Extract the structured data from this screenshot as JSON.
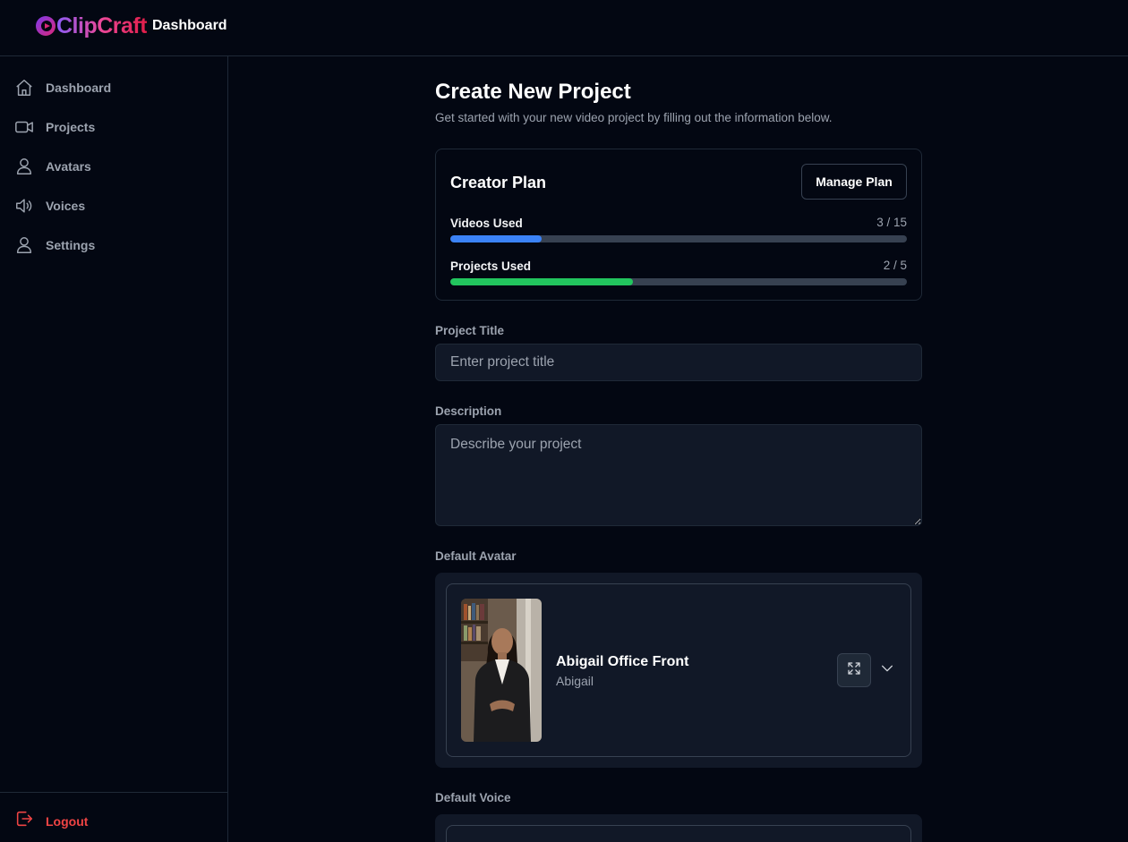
{
  "app": {
    "logo_text": "ClipCraft",
    "header_title": "Dashboard"
  },
  "sidebar": {
    "items": [
      {
        "label": "Dashboard",
        "icon": "home-icon"
      },
      {
        "label": "Projects",
        "icon": "video-camera-icon"
      },
      {
        "label": "Avatars",
        "icon": "user-icon"
      },
      {
        "label": "Voices",
        "icon": "speaker-icon"
      },
      {
        "label": "Settings",
        "icon": "user-icon"
      }
    ],
    "logout_label": "Logout"
  },
  "page": {
    "title": "Create New Project",
    "subtitle": "Get started with your new video project by filling out the information below."
  },
  "plan": {
    "name": "Creator Plan",
    "manage_label": "Manage Plan",
    "videos": {
      "label": "Videos Used",
      "count_text": "3 / 15",
      "used": 3,
      "total": 15,
      "color": "#3b82f6"
    },
    "projects": {
      "label": "Projects Used",
      "count_text": "2 / 5",
      "used": 2,
      "total": 5,
      "color": "#22c55e"
    }
  },
  "form": {
    "title_label": "Project Title",
    "title_placeholder": "Enter project title",
    "title_value": "",
    "description_label": "Description",
    "description_placeholder": "Describe your project",
    "description_value": "",
    "avatar_label": "Default Avatar",
    "avatar": {
      "name": "Abigail Office Front",
      "person": "Abigail"
    },
    "voice_label": "Default Voice"
  },
  "colors": {
    "background": "#030712",
    "surface": "#111827",
    "border": "#1f2937",
    "logout": "#ef4444"
  }
}
